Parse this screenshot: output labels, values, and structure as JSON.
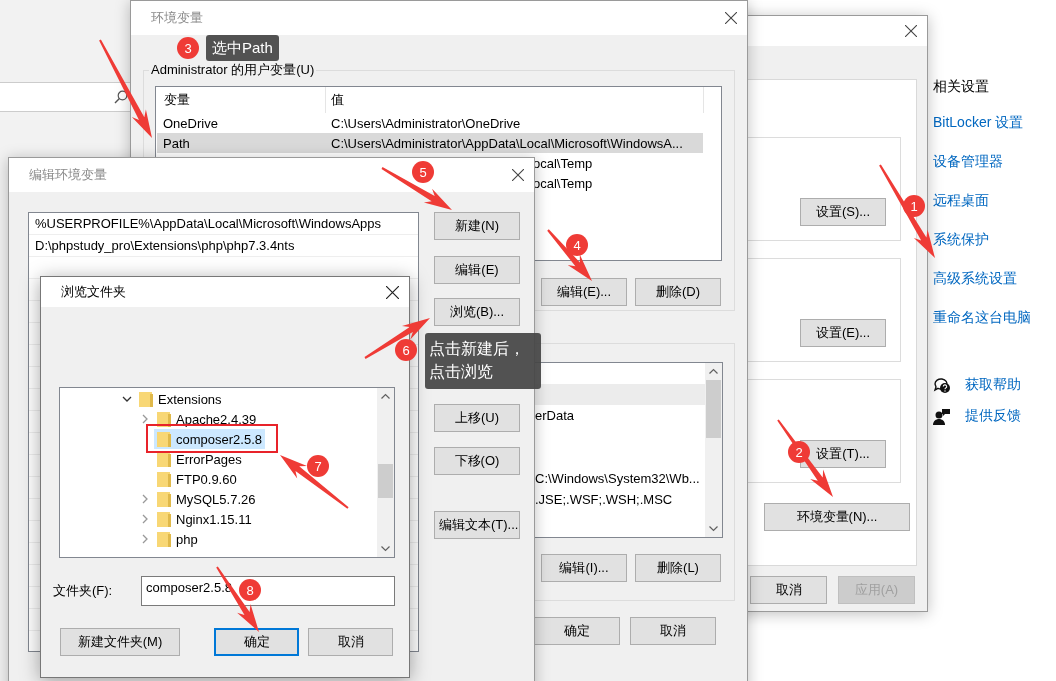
{
  "related_settings": {
    "heading": "相关设置",
    "links": [
      "BitLocker 设置",
      "设备管理器",
      "远程桌面",
      "系统保护",
      "高级系统设置",
      "重命名这台电脑"
    ],
    "support_links": [
      {
        "kind": "help",
        "label": "获取帮助"
      },
      {
        "kind": "feedback",
        "label": "提供反馈"
      }
    ]
  },
  "system_properties": {
    "group_buttons": [
      "设置(S)...",
      "设置(E)...",
      "设置(T)..."
    ],
    "environment_button": "环境变量(N)...",
    "footer_buttons": [
      {
        "label": "取消",
        "disabled": false
      },
      {
        "label": "应用(A)",
        "disabled": true
      }
    ]
  },
  "environment_variables": {
    "title": "环境变量",
    "user_group": "Administrator 的用户变量(U)",
    "columns": [
      "变量",
      "值"
    ],
    "user_rows": [
      {
        "name": "OneDrive",
        "value": "C:\\Users\\Administrator\\OneDrive",
        "selected": false
      },
      {
        "name": "Path",
        "value": "C:\\Users\\Administrator\\AppData\\Local\\Microsoft\\WindowsA...",
        "selected": true
      },
      {
        "value": "ocal\\Temp",
        "selected": false
      },
      {
        "value": "ocal\\Temp",
        "selected": false
      }
    ],
    "user_buttons": [
      "编辑(E)...",
      "删除(D)"
    ],
    "system_rows": [
      {
        "selected": false
      },
      {
        "selected": true
      },
      {
        "value": "erData",
        "selected": false
      },
      {
        "selected": false
      },
      {
        "selected": false
      },
      {
        "value": "C:\\Windows\\System32\\Wb...",
        "selected": false
      },
      {
        "value": ".JSE;.WSF;.WSH;.MSC",
        "selected": false
      }
    ],
    "system_buttons": [
      "编辑(I)...",
      "删除(L)"
    ],
    "footer_buttons": [
      "确定",
      "取消"
    ]
  },
  "edit_variable": {
    "title": "编辑环境变量",
    "entries": [
      "%USERPROFILE%\\AppData\\Local\\Microsoft\\WindowsApps",
      "D:\\phpstudy_pro\\Extensions\\php\\php7.3.4nts"
    ],
    "buttons": [
      "新建(N)",
      "编辑(E)",
      "浏览(B)...",
      "上移(U)",
      "下移(O)",
      "编辑文本(T)..."
    ]
  },
  "browse_folder": {
    "title": "浏览文件夹",
    "tree": [
      {
        "label": "Extensions",
        "expandable": true,
        "expanded": true,
        "selected": false,
        "children": [
          {
            "label": "Apache2.4.39",
            "expandable": true,
            "expanded": false,
            "selected": false
          },
          {
            "label": "composer2.5.8",
            "expandable": false,
            "selected": true
          },
          {
            "label": "ErrorPages",
            "expandable": false,
            "selected": false
          },
          {
            "label": "FTP0.9.60",
            "expandable": false,
            "selected": false
          },
          {
            "label": "MySQL5.7.26",
            "expandable": true,
            "expanded": false,
            "selected": false
          },
          {
            "label": "Nginx1.15.11",
            "expandable": true,
            "expanded": false,
            "selected": false
          },
          {
            "label": "php",
            "expandable": true,
            "expanded": false,
            "selected": false
          }
        ]
      }
    ],
    "folder_label": "文件夹(F):",
    "folder_value": "composer2.5.8",
    "buttons": [
      {
        "label": "新建文件夹(M)",
        "default": false
      },
      {
        "label": "确定",
        "default": true
      },
      {
        "label": "取消",
        "default": false
      }
    ]
  },
  "annotations": {
    "steps": [
      "1",
      "2",
      "3",
      "4",
      "5",
      "6",
      "7",
      "8"
    ],
    "tooltips": [
      {
        "lines": [
          "选中Path"
        ]
      },
      {
        "lines": [
          "点击新建后，",
          "点击浏览"
        ]
      }
    ]
  }
}
